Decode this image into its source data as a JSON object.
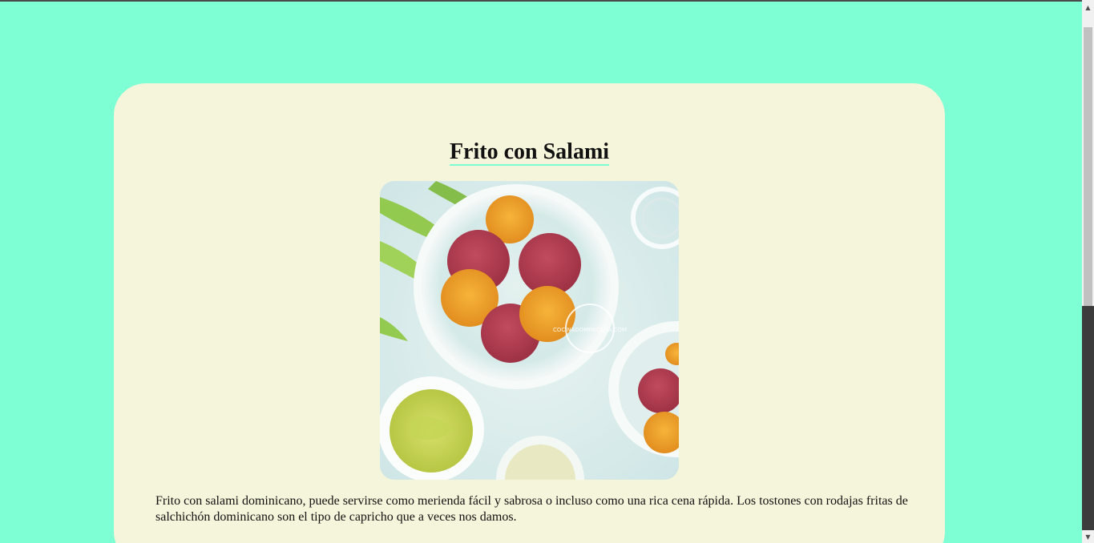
{
  "recipe": {
    "title": "Frito con Salami",
    "image_alt": "Frito con Salami",
    "watermark": "COCINADOMINICANA.COM",
    "description": "Frito con salami dominicano, puede servirse como merienda fácil y sabrosa o incluso como una rica cena rápida. Los tostones con rodajas fritas de salchichón dominicano son el tipo de capricho que a veces nos damos."
  },
  "colors": {
    "page_background": "#7fffd4",
    "card_background": "#f5f5dc",
    "title_underline": "#7fffd4"
  },
  "icons": {
    "scroll_up": "triangle-up-icon",
    "scroll_down": "triangle-down-icon"
  }
}
